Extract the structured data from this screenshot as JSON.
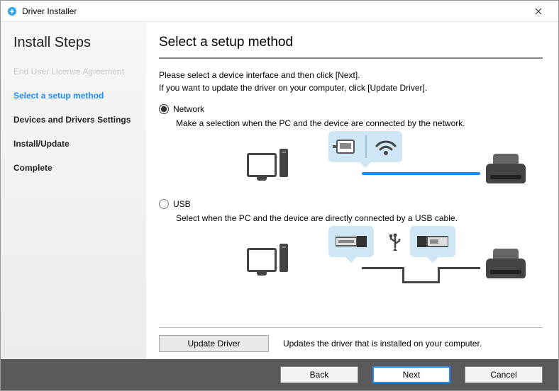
{
  "window": {
    "title": "Driver Installer"
  },
  "sidebar": {
    "heading": "Install Steps",
    "steps": [
      {
        "label": "End User License Agreement",
        "state": "done"
      },
      {
        "label": "Select a setup method",
        "state": "current"
      },
      {
        "label": "Devices and Drivers Settings",
        "state": "pending"
      },
      {
        "label": "Install/Update",
        "state": "pending"
      },
      {
        "label": "Complete",
        "state": "pending"
      }
    ]
  },
  "main": {
    "heading": "Select a setup method",
    "intro_line1": "Please select a device interface and then click [Next].",
    "intro_line2": "If you want to update the driver on your computer, click [Update Driver].",
    "options": {
      "network": {
        "label": "Network",
        "desc": "Make a selection when the PC and the device are connected by the network.",
        "selected": true
      },
      "usb": {
        "label": "USB",
        "desc": "Select when the PC and the device are directly connected by a USB cable.",
        "selected": false
      }
    },
    "update": {
      "button": "Update Driver",
      "desc": "Updates the driver that is installed on your computer."
    }
  },
  "footer": {
    "back": "Back",
    "next": "Next",
    "cancel": "Cancel"
  }
}
